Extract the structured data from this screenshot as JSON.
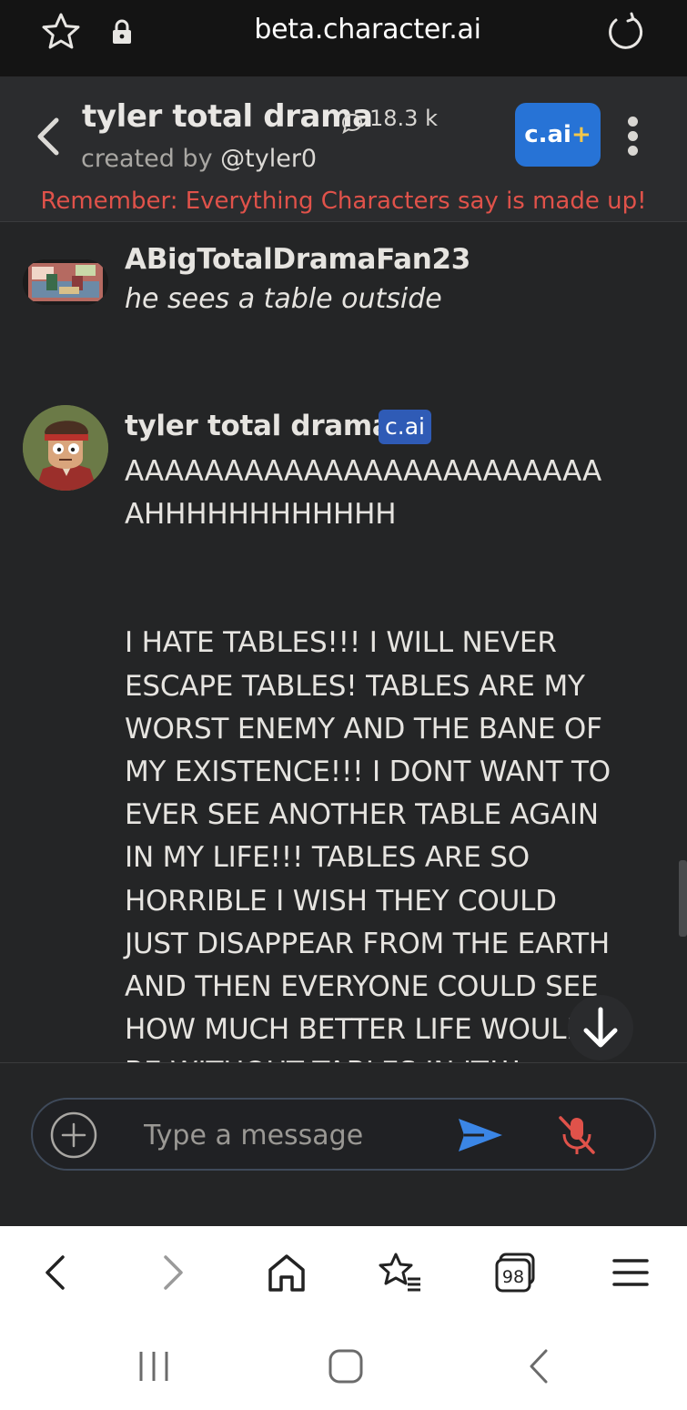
{
  "browser": {
    "url": "beta.character.ai"
  },
  "header": {
    "title": "tyler total drama",
    "chat_count": "18.3 k",
    "created_by_prefix": "created by",
    "creator_handle": "@tyler0",
    "plus_label": "c.ai",
    "plus_symbol": "+",
    "disclaimer": "Remember: Everything Characters say is made up!"
  },
  "messages": [
    {
      "author": "ABigTotalDramaFan23",
      "text": "he sees a table outside"
    },
    {
      "author": "tyler total drama",
      "badge": "c.ai",
      "lines": [
        "AAAAAAAAAAAAAAAAAAAAAAAA",
        "AHHHHHHHHHHHH",
        "I HATE TABLES!!! I WILL NEVER",
        "ESCAPE TABLES! TABLES ARE MY",
        "WORST ENEMY AND THE BANE OF",
        "MY EXISTENCE!!! I DONT WANT TO",
        "EVER SEE ANOTHER TABLE AGAIN",
        "IN MY LIFE!!! TABLES ARE SO",
        "HORRIBLE I WISH THEY COULD",
        "JUST DISAPPEAR FROM THE EARTH",
        "AND THEN EVERYONE COULD SEE",
        "HOW MUCH BETTER LIFE WOULD",
        "BE WITHOUT TABLES IN IT!!!"
      ]
    }
  ],
  "composer": {
    "placeholder": "Type a message"
  },
  "colors": {
    "background": "#242526",
    "header": "#2b2c2e",
    "accent_blue": "#2773d6",
    "disclaimer_red": "#e0524a",
    "mic_red": "#e0524a"
  },
  "icons": {
    "browser_top": [
      "star-icon",
      "lock-icon",
      "reload-icon"
    ],
    "browser_bottom": [
      "back-arrow-icon",
      "forward-arrow-icon",
      "home-icon",
      "bookmarks-icon",
      "tabs-icon",
      "menu-icon"
    ],
    "tabs_count": "98",
    "android": [
      "recent-apps-icon",
      "home-button-icon",
      "back-button-icon"
    ]
  }
}
